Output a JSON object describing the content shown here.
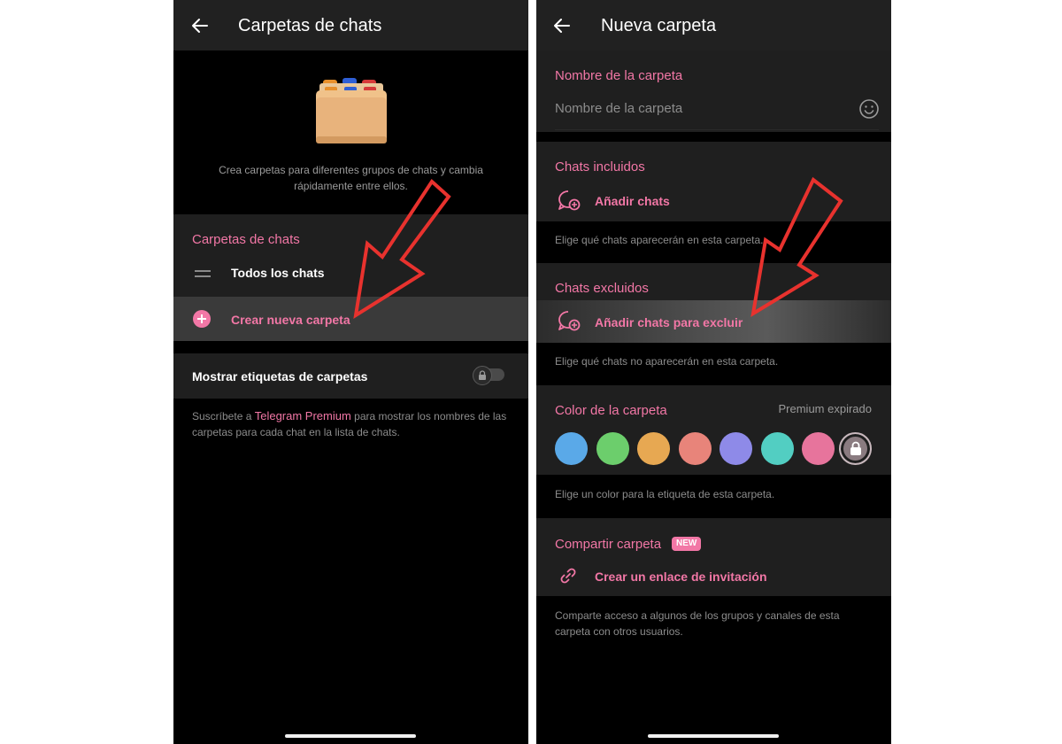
{
  "left": {
    "title": "Carpetas de chats",
    "intro": "Crea carpetas para diferentes grupos de chats y cambia rápidamente entre ellos.",
    "folders_header": "Carpetas de chats",
    "all_chats": "Todos los chats",
    "create_folder": "Crear nueva carpeta",
    "show_tags_label": "Mostrar etiquetas de carpetas",
    "show_tags_toggle": "off",
    "footer_prefix": "Suscríbete a ",
    "footer_link": "Telegram Premium",
    "footer_suffix": " para mostrar los nombres de las carpetas para cada chat en la lista de chats."
  },
  "right": {
    "title": "Nueva carpeta",
    "name_header": "Nombre de la carpeta",
    "name_placeholder": "Nombre de la carpeta",
    "included_header": "Chats incluidos",
    "add_chats": "Añadir chats",
    "included_hint": "Elige qué chats aparecerán en esta carpeta.",
    "excluded_header": "Chats excluidos",
    "add_excluded": "Añadir chats para excluir",
    "excluded_hint": "Elige qué chats no aparecerán en esta carpeta.",
    "color_header": "Color de la carpeta",
    "premium_status": "Premium expirado",
    "colors": [
      "#5aa9e8",
      "#6cce6c",
      "#e7a852",
      "#e8847a",
      "#8e8ae8",
      "#52cec2",
      "#e7749c"
    ],
    "color_hint": "Elige un color para la etiqueta de esta carpeta.",
    "share_header": "Compartir carpeta",
    "new_badge": "NEW",
    "invite_link": "Crear un enlace de invitación",
    "share_hint": "Comparte acceso a algunos de los grupos y canales de esta carpeta con otros usuarios."
  },
  "colors": {
    "accent": "#f277a6",
    "surface": "#1f1f1f",
    "background": "#000000",
    "arrow": "#e8322e"
  }
}
